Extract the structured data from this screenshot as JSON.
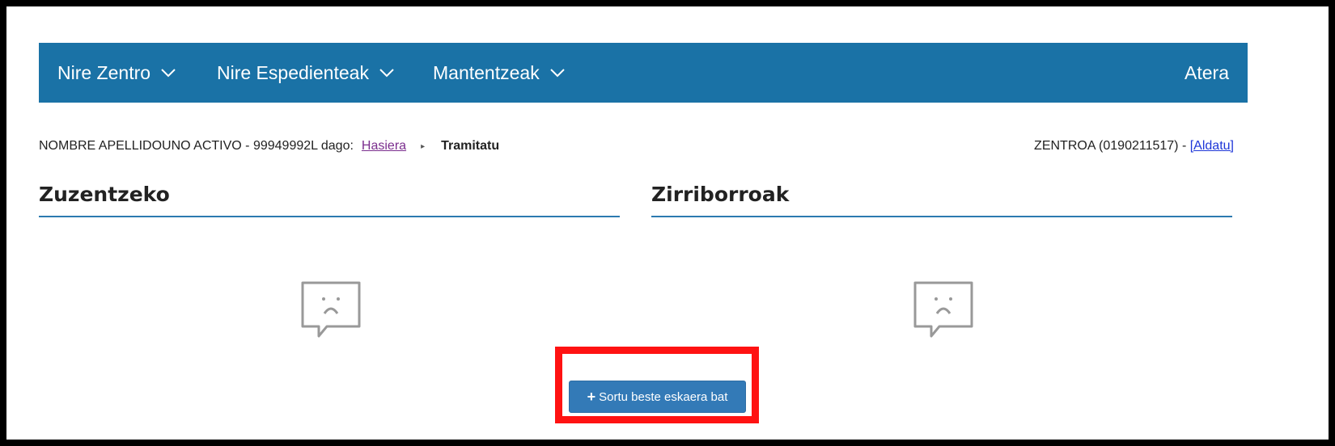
{
  "navbar": {
    "items": [
      {
        "label": "Nire Zentro",
        "icon": "chevron-down-icon"
      },
      {
        "label": "Nire Espedienteak",
        "icon": "chevron-down-icon"
      },
      {
        "label": "Mantentzeak",
        "icon": "chevron-down-icon"
      }
    ],
    "logout_label": "Atera",
    "background_color": "#1a72a6"
  },
  "breadcrumb": {
    "user_prefix": "NOMBRE APELLIDOUNO ACTIVO - 99949992L dago:",
    "home_link": "Hasiera",
    "separator_icon": "caret-right-icon",
    "current": "Tramitatu"
  },
  "center_info": {
    "label": "ZENTROA (0190211517) - ",
    "change_link": "[Aldatu]"
  },
  "panels": {
    "to_correct": {
      "title": "Zuzentzeko",
      "empty_icon": "sad-speech-bubble-icon"
    },
    "drafts": {
      "title": "Zirriborroak",
      "empty_icon": "sad-speech-bubble-icon"
    }
  },
  "actions": {
    "create_request_icon": "plus-icon",
    "create_request_label": "Sortu beste eskaera bat",
    "highlight_color": "#ff1212"
  }
}
